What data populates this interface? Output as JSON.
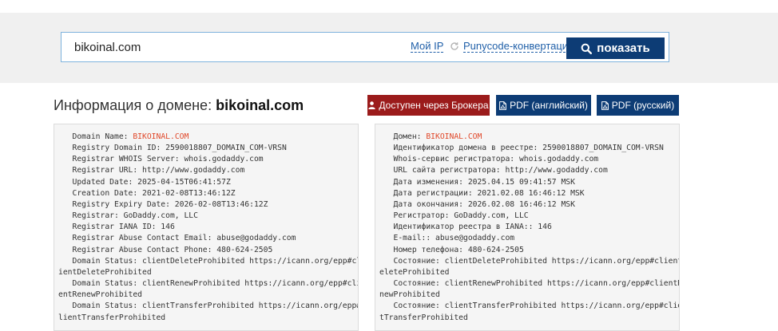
{
  "search": {
    "value": "bikoinal.com",
    "my_ip_label": "Мой IP",
    "punycode_label": "Punycode-конвертация",
    "show_label": "показать"
  },
  "header": {
    "title_prefix": "Информация о домене: ",
    "title_domain": "bikoinal.com"
  },
  "actions": {
    "broker_label": "Доступен через Брокера",
    "pdf_en_label": "PDF (английский)",
    "pdf_ru_label": "PDF (русский)"
  },
  "colors": {
    "primary": "#0d3c75",
    "broker": "#9b1b1b",
    "highlight": "#e0482a",
    "link": "#1f5fa8"
  },
  "whois_en": [
    {
      "label": "   Domain Name: ",
      "value": "BIKOINAL.COM",
      "hl": true
    },
    {
      "label": "   Registry Domain ID: 2590018807_DOMAIN_COM-VRSN"
    },
    {
      "label": "   Registrar WHOIS Server: whois.godaddy.com"
    },
    {
      "label": "   Registrar URL: http://www.godaddy.com"
    },
    {
      "label": "   Updated Date: 2025-04-15T06:41:57Z"
    },
    {
      "label": "   Creation Date: 2021-02-08T13:46:12Z"
    },
    {
      "label": "   Registry Expiry Date: 2026-02-08T13:46:12Z"
    },
    {
      "label": "   Registrar: GoDaddy.com, LLC"
    },
    {
      "label": "   Registrar IANA ID: 146"
    },
    {
      "label": "   Registrar Abuse Contact Email: abuse@godaddy.com"
    },
    {
      "label": "   Registrar Abuse Contact Phone: 480-624-2505"
    },
    {
      "label": "   Domain Status: clientDeleteProhibited https://icann.org/epp#cl"
    },
    {
      "label": "ientDeleteProhibited"
    },
    {
      "label": "   Domain Status: clientRenewProhibited https://icann.org/epp#cli"
    },
    {
      "label": "entRenewProhibited"
    },
    {
      "label": "   Domain Status: clientTransferProhibited https://icann.org/epp#c"
    },
    {
      "label": "lientTransferProhibited"
    }
  ],
  "whois_ru": [
    {
      "label": "   Домен: ",
      "value": "BIKOINAL.COM",
      "hl": true
    },
    {
      "label": "   Идентификатор домена в реестре: 2590018807_DOMAIN_COM-VRSN"
    },
    {
      "label": "   Whois-сервис регистратора: whois.godaddy.com"
    },
    {
      "label": "   URL сайта регистратора: http://www.godaddy.com"
    },
    {
      "label": "   Дата изменения: 2025.04.15 09:41:57 MSK"
    },
    {
      "label": "   Дата регистрации: 2021.02.08 16:46:12 MSK"
    },
    {
      "label": "   Дата окончания: 2026.02.08 16:46:12 MSK"
    },
    {
      "label": "   Регистратор: GoDaddy.com, LLC"
    },
    {
      "label": "   Идентификатор реестра в IANA:: 146"
    },
    {
      "label": "   E-mail:: abuse@godaddy.com"
    },
    {
      "label": "   Номер телефона: 480-624-2505"
    },
    {
      "label": "   Состояние: clientDeleteProhibited https://icann.org/epp#clientD"
    },
    {
      "label": "eleteProhibited"
    },
    {
      "label": "   Состояние: clientRenewProhibited https://icann.org/epp#clientRe"
    },
    {
      "label": "newProhibited"
    },
    {
      "label": "   Состояние: clientTransferProhibited https://icann.org/epp#clien"
    },
    {
      "label": "tTransferProhibited"
    }
  ]
}
